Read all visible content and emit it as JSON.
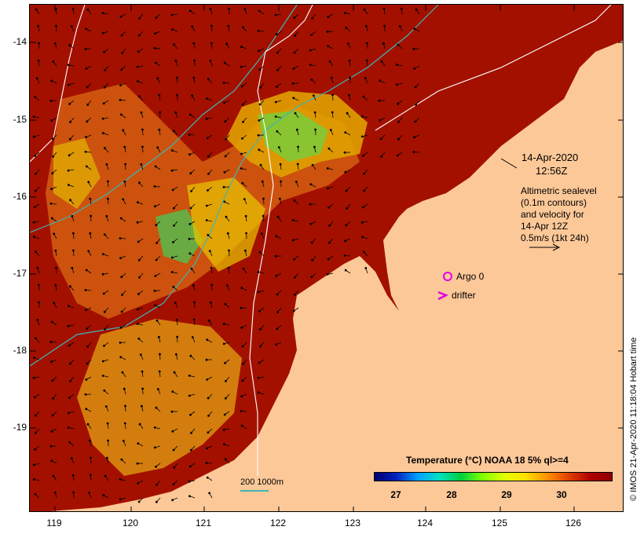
{
  "map": {
    "y_ticks": [
      "-14",
      "-15",
      "-16",
      "-17",
      "-18",
      "-19"
    ],
    "x_ticks": [
      "119",
      "120",
      "121",
      "122",
      "123",
      "124",
      "125",
      "126"
    ],
    "date_line1": "14-Apr-2020",
    "date_line2": "12:56Z",
    "altimetry_lines": [
      "Altimetric sealevel",
      "(0.1m contours)",
      "and velocity for",
      "14-Apr 12Z",
      "0.5m/s (1kt 24h)"
    ],
    "argo_label": "Argo 0",
    "drifter_label": "drifter",
    "scale_label": "200  1000m",
    "credit": "© IMOS 21-Apr-2020 11:18:04 Hobart time",
    "colorbar": {
      "title": "Temperature (°C) NOAA 18 5% ql>=4",
      "ticks": [
        "27",
        "28",
        "29",
        "30"
      ]
    },
    "colors": {
      "land": "#fdc898",
      "warm": "#a31000",
      "mid": "#d05a10",
      "yellow": "#e8d000",
      "green": "#40c040",
      "contour": "#3fb5b5",
      "argo": "#e000e0"
    }
  }
}
